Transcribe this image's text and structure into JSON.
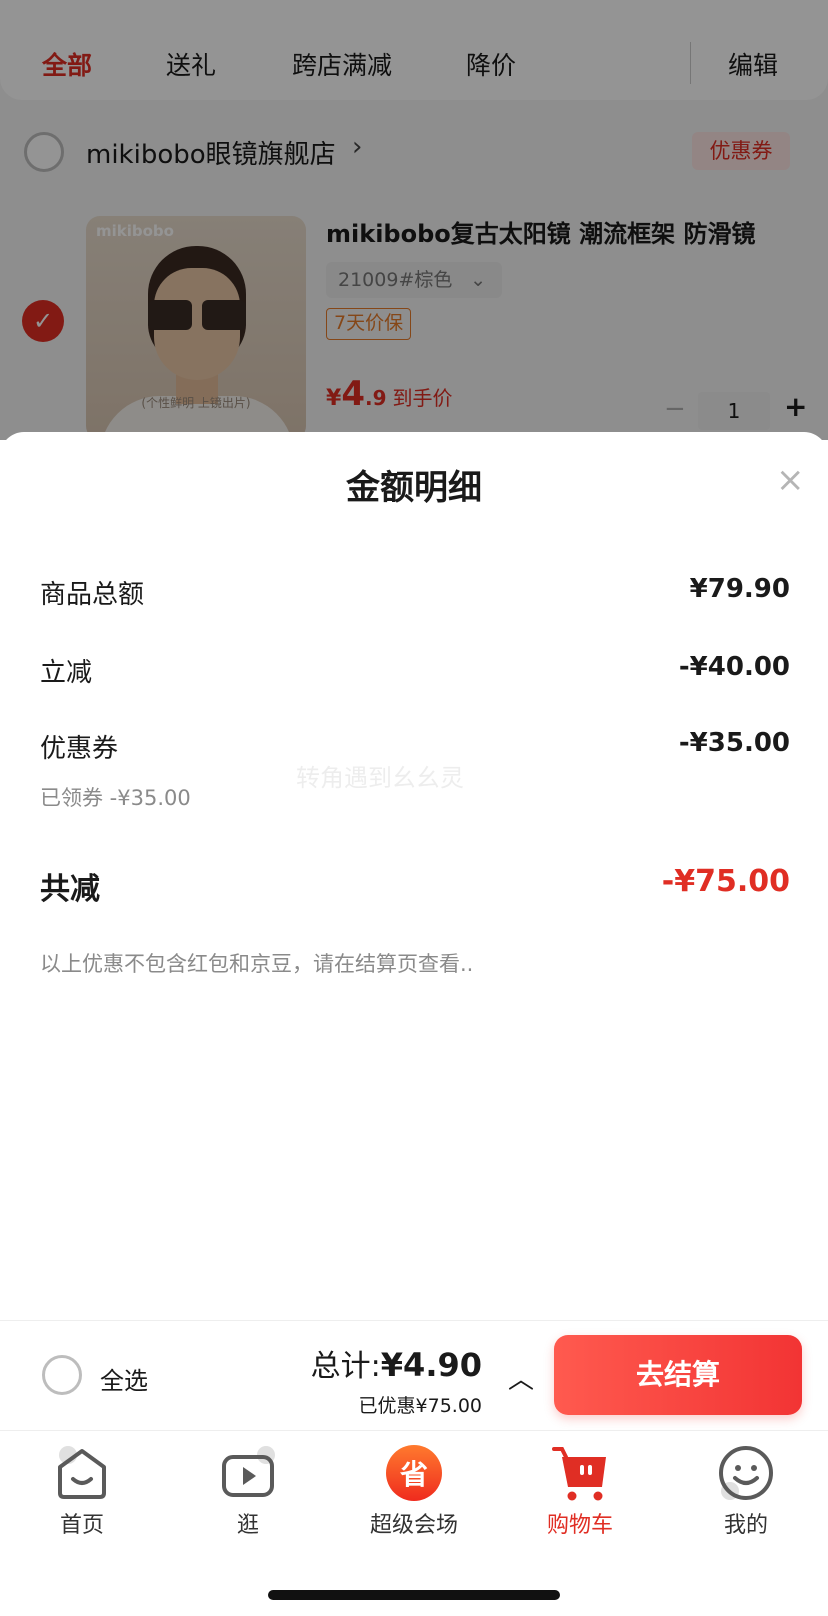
{
  "filter_tabs": {
    "all": "全部",
    "gift": "送礼",
    "cross_store": "跨店满减",
    "price_drop": "降价",
    "edit": "编辑"
  },
  "store": {
    "name": "mikibobo眼镜旗舰店",
    "chevron": "›",
    "coupon_tag": "优惠券"
  },
  "product": {
    "image_brand": "mikibobo",
    "image_caption": "(个性鲜明 上镜出片)",
    "title": "mikibobo复古太阳镜 潮流框架 防滑镜",
    "spec": "21009#棕色",
    "spec_arrow": "⌄",
    "guarantee": "7天价保",
    "price_symbol": "¥",
    "price_int": "4",
    "price_dec": ".9",
    "price_label": "到手价",
    "qty_minus": "−",
    "quantity": "1",
    "qty_plus": "+"
  },
  "sheet": {
    "title": "金额明细",
    "close": "×",
    "rows": [
      {
        "label": "商品总额",
        "value": "¥79.90"
      },
      {
        "label": "立减",
        "value": "-¥40.00"
      },
      {
        "label": "优惠券",
        "value": "-¥35.00",
        "sub": "已领券 -¥35.00"
      }
    ],
    "total_label": "共减",
    "total_value": "-¥75.00",
    "note": "以上优惠不包含红包和京豆，请在结算页查看..",
    "watermark": "转角遇到幺幺灵"
  },
  "checkout": {
    "select_all": "全选",
    "total_prefix": "总计:",
    "total_amount": "¥4.90",
    "saved": "已优惠¥75.00",
    "chevron": "︿",
    "button": "去结算"
  },
  "tab_bar": {
    "items": [
      {
        "label": "首页",
        "icon": "home-icon"
      },
      {
        "label": "逛",
        "icon": "play-icon"
      },
      {
        "label": "超级会场",
        "icon": "super-venue-icon"
      },
      {
        "label": "购物车",
        "icon": "cart-icon",
        "active": true
      },
      {
        "label": "我的",
        "icon": "profile-icon"
      }
    ],
    "venue_glyph": "省"
  },
  "colors": {
    "accent": "#e02e24",
    "button_gradient_start": "#ff5a4f",
    "button_gradient_end": "#f23434",
    "guarantee": "#e67b2a"
  }
}
